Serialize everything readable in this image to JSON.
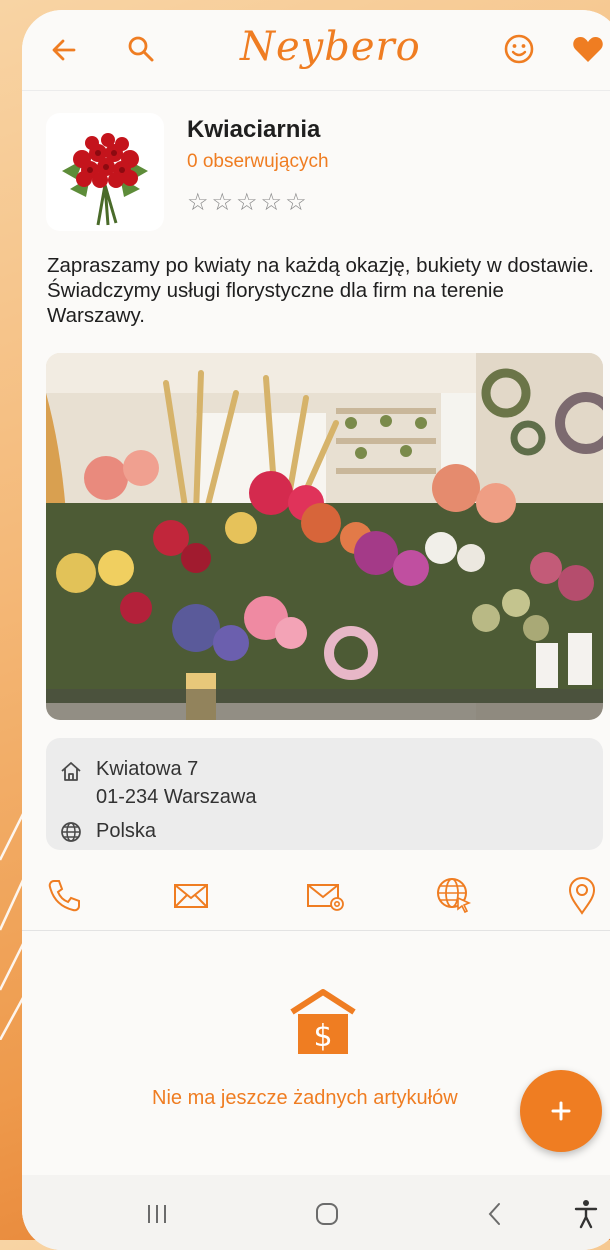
{
  "app": {
    "logo_text": "Neybero",
    "accent_color": "#ef7d22"
  },
  "topbar": {
    "icons": [
      "back-arrow-icon",
      "search-icon",
      "smiley-icon",
      "heart-icon"
    ]
  },
  "shop": {
    "name": "Kwiaciarnia",
    "followers": "0 obserwujących",
    "rating": 0,
    "rating_max": 5,
    "stars_text": "☆☆☆☆☆",
    "description": "Zapraszamy po kwiaty na każdą okazję, bukiety w dostawie. Świadczymy usługi florystyczne dla firm na terenie Warszawy."
  },
  "gallery": {
    "current_page": 1,
    "total_pages": 1
  },
  "address": {
    "street": "Kwiatowa 7",
    "city_line": "01-234 Warszawa",
    "country": "Polska"
  },
  "actions": [
    "phone-icon",
    "mail-icon",
    "email-at-icon",
    "website-icon",
    "location-pin-icon"
  ],
  "articles": {
    "empty_message": "Nie ma jeszcze żadnych artykułów",
    "fab_label": "+"
  },
  "system_nav": [
    "recent-apps-icon",
    "home-icon",
    "back-icon",
    "accessibility-icon"
  ]
}
